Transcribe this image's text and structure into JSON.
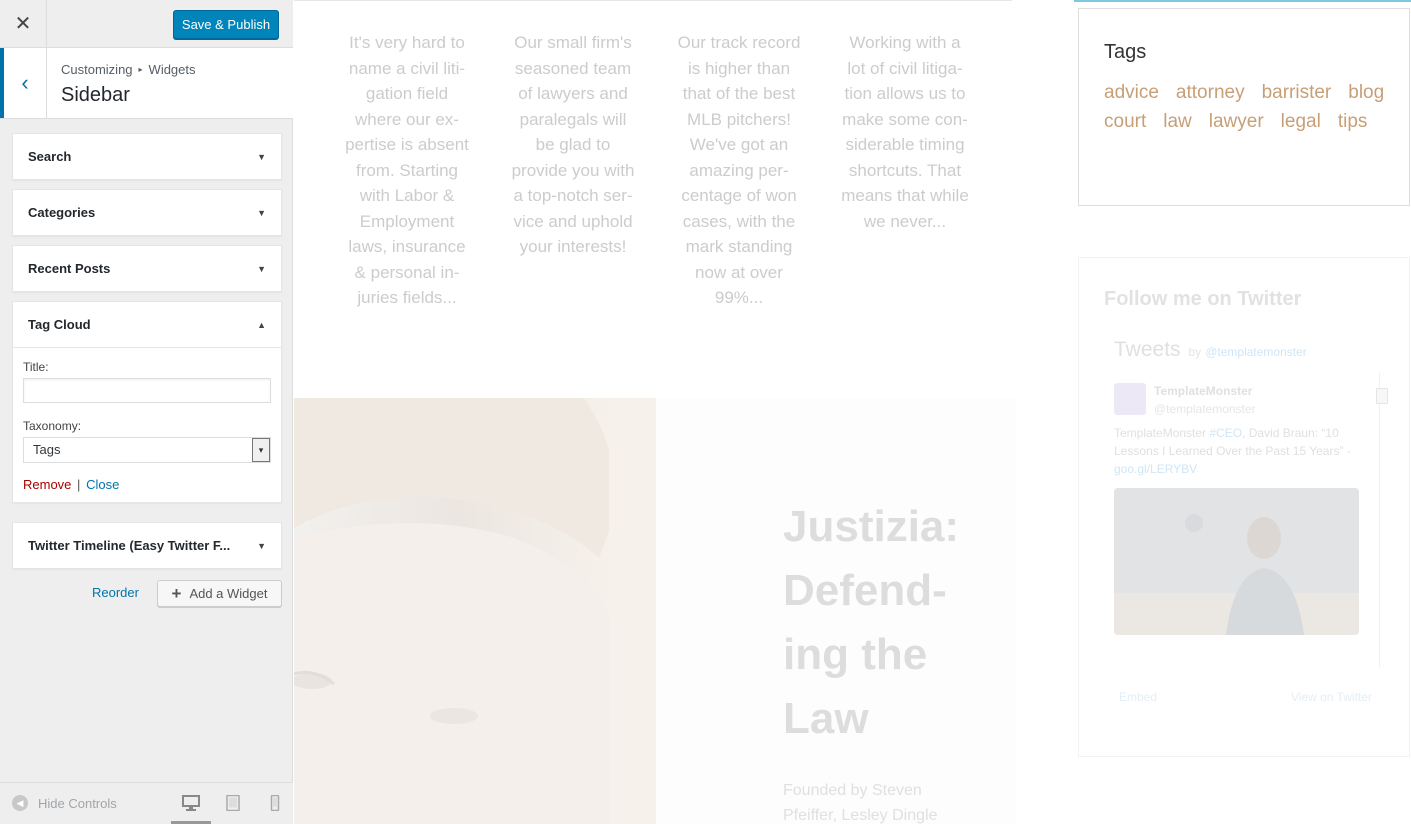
{
  "colors": {
    "accent": "#0085ba",
    "link": "#0073aa",
    "remove": "#aa0000",
    "tag": "#c79f76"
  },
  "topbar": {
    "close_icon": "✕",
    "save_label": "Save & Publish"
  },
  "section": {
    "back_icon": "‹",
    "breadcrumb": {
      "parent": "Customizing",
      "separator": "▸",
      "child": "Widgets"
    },
    "title": "Sidebar"
  },
  "widgets": [
    {
      "label": "Search",
      "expanded": false,
      "arrow": "▼"
    },
    {
      "label": "Categories",
      "expanded": false,
      "arrow": "▼"
    },
    {
      "label": "Recent Posts",
      "expanded": false,
      "arrow": "▼"
    },
    {
      "label": "Tag Cloud",
      "expanded": true,
      "arrow": "▲",
      "form": {
        "title_label": "Title:",
        "title_value": "",
        "taxonomy_label": "Taxonomy:",
        "taxonomy_selected": "Tags",
        "select_arrow": "▾",
        "remove_label": "Remove",
        "divider": "|",
        "close_label": "Close"
      }
    },
    {
      "label": "Twitter Timeline (Easy Twitter F...",
      "expanded": false,
      "arrow": "▼"
    }
  ],
  "actions": {
    "reorder_label": "Reorder",
    "add_widget_icon": "+",
    "add_widget_label": "Add a Widget"
  },
  "footer": {
    "hide_controls_icon": "◀",
    "hide_controls_label": "Hide Controls",
    "devices": [
      "desktop-icon",
      "tablet-icon",
      "mobile-icon"
    ]
  },
  "preview": {
    "features": [
      "It's very hard to name a civil liti-gation field where our ex-pertise is absent from. Starting with Labor & Employment laws, insurance & personal in-juries fields...",
      "Our small firm's seasoned team of lawyers and paralegals will be glad to provide you with a top-notch ser-vice and uphold your interests!",
      "Our track record is higher than that of the best MLB pitchers! We've got an amazing per-centage of won cases, with the mark standing now at over 99%...",
      "Working with a lot of civil litiga-tion allows us to make some con-siderable timing shortcuts. That means that while we never..."
    ],
    "hero_title": "Justizia: Defend-ing the Law",
    "hero_sub": "Founded by Steven Pfeiffer, Lesley Dingle",
    "tags_widget": {
      "title": "Tags",
      "tags": [
        "advice",
        "attorney",
        "barrister",
        "blog",
        "court",
        "law",
        "lawyer",
        "legal",
        "tips"
      ]
    },
    "twitter_widget": {
      "title": "Follow me on Twitter",
      "tweets_title": "Tweets",
      "tweets_by": "by",
      "tweets_handle": "@templatemonster",
      "tweet_name": "TemplateMonster",
      "tweet_handle": "@templatemonster",
      "tweet_text_a": "TemplateMonster ",
      "tweet_hashtag": "#CEO",
      "tweet_text_b": ", David Braun: “10 Lessons I Learned Over the Past 15 Years” - ",
      "tweet_link": "goo.gl/LERYBV",
      "embed_label": "Embed",
      "view_label": "View on Twitter"
    }
  }
}
